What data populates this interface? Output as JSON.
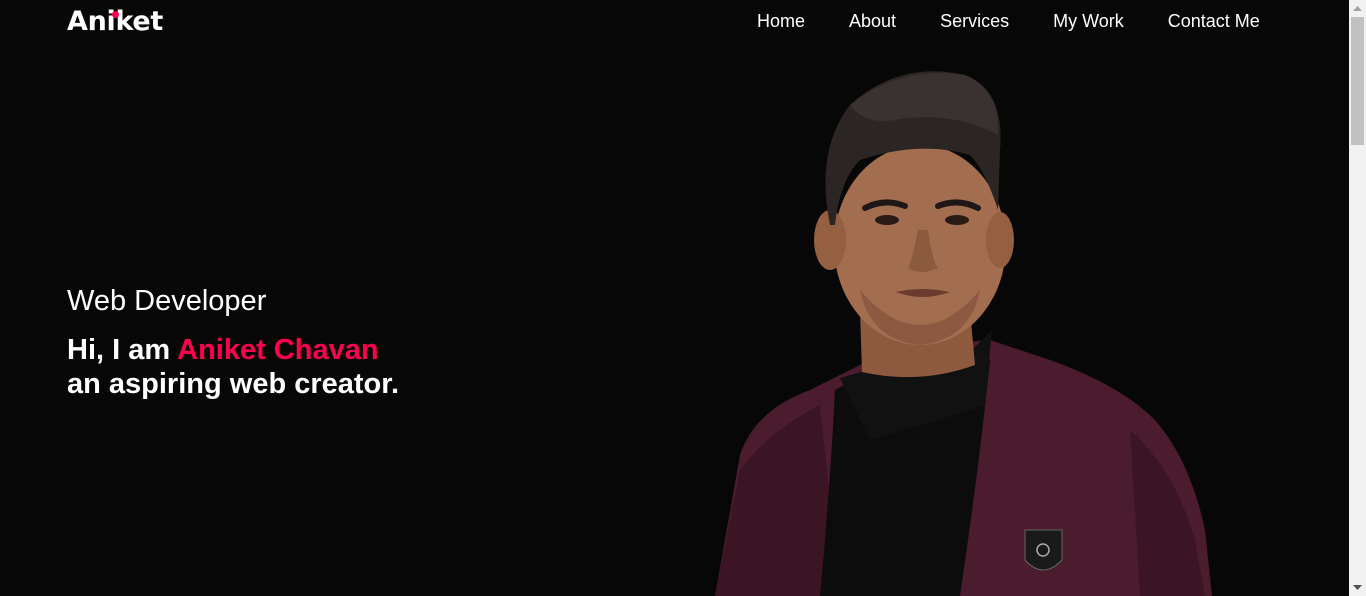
{
  "header": {
    "logo": "Aniket",
    "nav": [
      "Home",
      "About",
      "Services",
      "My Work",
      "Contact Me"
    ]
  },
  "hero": {
    "subtitle": "Web Developer",
    "greeting": "Hi, I am ",
    "name": "Aniket Chavan",
    "tagline": "an aspiring web creator."
  },
  "colors": {
    "background": "#080708",
    "accent": "#ff004f",
    "text": "#ffffff"
  },
  "icons": {
    "scroll_up": "triangle-up-icon",
    "scroll_down": "triangle-down-icon"
  }
}
